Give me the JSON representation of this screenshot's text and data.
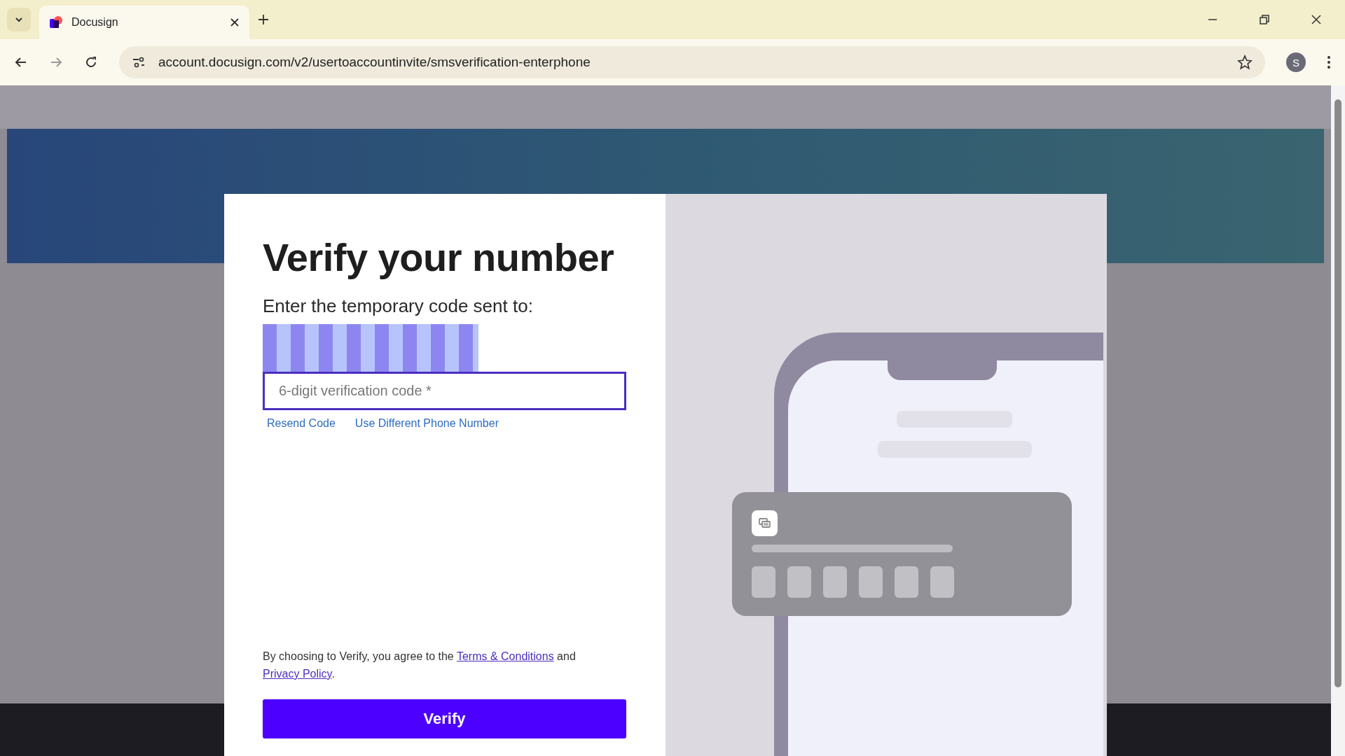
{
  "browser": {
    "tab": {
      "title": "Docusign",
      "selected": true
    },
    "url": "account.docusign.com/v2/usertoaccountinvite/smsverification-enterphone",
    "profile_initial": "S"
  },
  "dialog": {
    "title": "Verify your number",
    "subtitle": "Enter the temporary code sent to:",
    "code_field": {
      "placeholder": "6-digit verification code *"
    },
    "links": [
      {
        "label": "Resend Code"
      },
      {
        "label": "Use Different Phone Number"
      }
    ],
    "agreement": {
      "before": "By choosing to Verify, you agree to the ",
      "terms": "Terms & Conditions",
      "middle": " and",
      "privacy": "Privacy Policy",
      "after": "."
    },
    "button": "Verify"
  }
}
